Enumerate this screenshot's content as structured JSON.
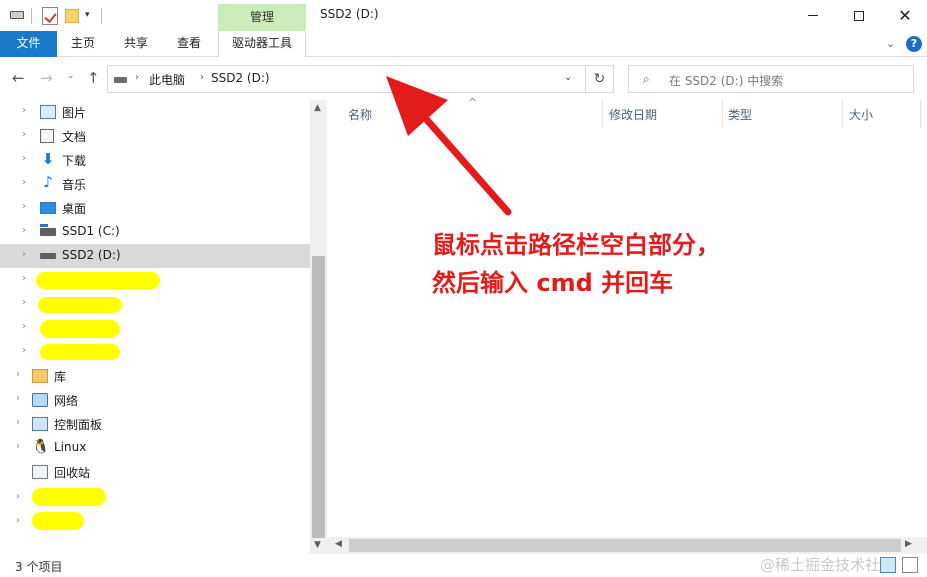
{
  "window": {
    "title": "SSD2 (D:)",
    "context_tab": "管理",
    "min_icon": "minimize-icon",
    "max_icon": "maximize-icon",
    "close_icon": "close-icon",
    "close_glyph": "✕"
  },
  "ribbon": {
    "tabs": [
      {
        "label": "文件"
      },
      {
        "label": "主页"
      },
      {
        "label": "共享"
      },
      {
        "label": "查看"
      },
      {
        "label": "驱动器工具"
      }
    ],
    "expand_glyph": "⌄",
    "help_glyph": "?"
  },
  "address": {
    "back_glyph": "←",
    "forward_glyph": "→",
    "recent_glyph": "⌄",
    "up_glyph": "↑",
    "crumbs": [
      "此电脑",
      "SSD2 (D:)"
    ],
    "crumb_sep": "›",
    "dropdown_glyph": "⌄",
    "refresh_glyph": "↻",
    "search_placeholder": "在 SSD2 (D:) 中搜索",
    "search_glyph": "⌕"
  },
  "nav": {
    "expander": "›",
    "items": [
      {
        "label": "图片",
        "icon": "pictures-icon"
      },
      {
        "label": "文档",
        "icon": "documents-icon"
      },
      {
        "label": "下载",
        "icon": "downloads-icon",
        "glyph": "⬇"
      },
      {
        "label": "音乐",
        "icon": "music-icon",
        "glyph": "♪"
      },
      {
        "label": "桌面",
        "icon": "desktop-icon"
      },
      {
        "label": "SSD1 (C:)",
        "icon": "drive-icon"
      },
      {
        "label": "SSD2 (D:)",
        "icon": "drive-icon",
        "selected": true
      },
      {
        "label": "库",
        "icon": "library-icon"
      },
      {
        "label": "网络",
        "icon": "network-icon"
      },
      {
        "label": "控制面板",
        "icon": "control-panel-icon"
      },
      {
        "label": "Linux",
        "icon": "linux-icon",
        "glyph": "🐧"
      },
      {
        "label": "回收站",
        "icon": "recycle-bin-icon"
      }
    ]
  },
  "columns": {
    "name": "名称",
    "date": "修改日期",
    "type": "类型",
    "size": "大小",
    "sort_glyph": "^"
  },
  "annotation": {
    "line1": "鼠标点击路径栏空白部分，",
    "line2": "然后输入 cmd 并回车",
    "color": "#e31b1b"
  },
  "status": {
    "items_count": "3 个项目",
    "watermark": "@稀土掘金技术社区"
  },
  "scroll": {
    "up": "▲",
    "down": "▼",
    "left": "◀",
    "right": "▶"
  },
  "colors": {
    "file_tab": "#1979ca",
    "context_tab": "#c9ecb8",
    "selection": "#d9d9d9",
    "redaction": "#ffff00"
  }
}
